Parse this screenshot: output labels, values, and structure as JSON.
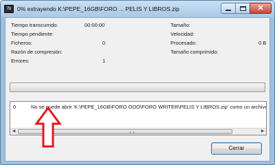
{
  "window": {
    "icon_text": "7z",
    "title": "0% extrayendo K:\\PEPE_16GB\\FORO  ... PELIS Y LIBROS.zip"
  },
  "stats": {
    "elapsed_label": "Tiempo transcurrido:",
    "elapsed_value": "00:00:00",
    "remaining_label": "Tiempo pendiente:",
    "files_label": "Ficheros:",
    "files_value": "0",
    "ratio_label": "Razón de compresión:",
    "errors_label": "Errores:",
    "errors_value": "1",
    "size_label": "Tamaño:",
    "speed_label": "Velocidad:",
    "processed_label": "Procesado:",
    "processed_value": "0 B",
    "compressed_label": "Tamaño comprimido:"
  },
  "progress": {
    "percent": 0
  },
  "log": {
    "entries": [
      {
        "index": "0",
        "message": "No se puede abrir 'K:\\PEPE_16GB\\FORO OOO\\FORO WRITER\\PELIS Y LIBROS.zip' como un archivo c"
      }
    ]
  },
  "buttons": {
    "close_label": "Cerrar"
  },
  "colors": {
    "annotation_arrow": "#e8141c",
    "title_bar": "#b8d3ec"
  }
}
